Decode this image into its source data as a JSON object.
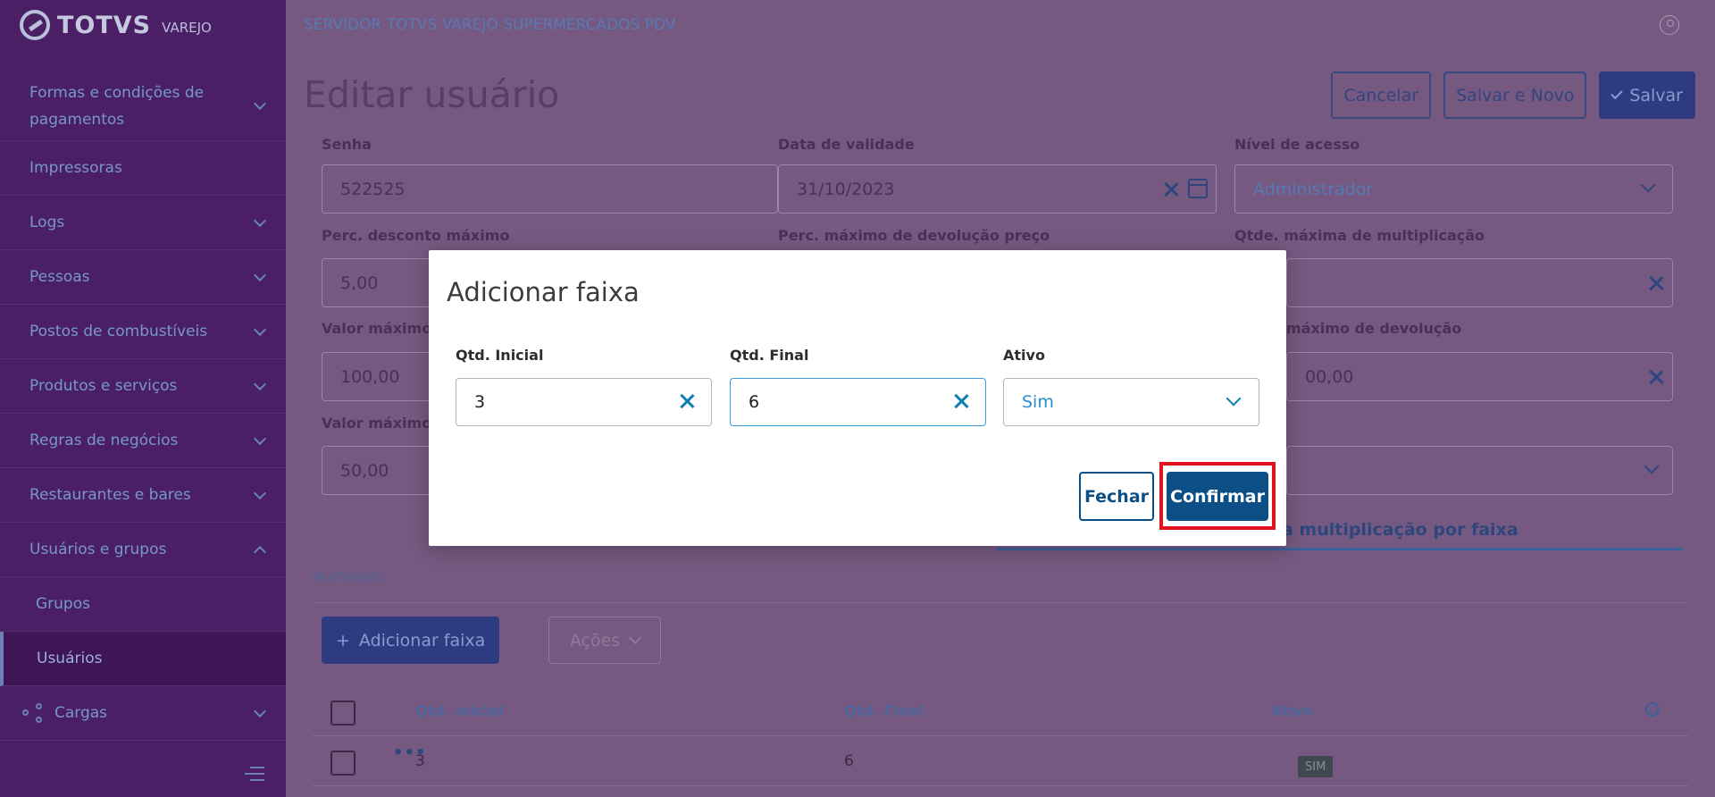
{
  "brand": {
    "name": "TOTVS",
    "sub": "VAREJO"
  },
  "header": {
    "server_title": "SERVIDOR TOTVS VAREJO SUPERMERCADOS PDV"
  },
  "sidebar": {
    "items": [
      {
        "label": "Formas e condições de pagamentos"
      },
      {
        "label": "Impressoras"
      },
      {
        "label": "Logs"
      },
      {
        "label": "Pessoas"
      },
      {
        "label": "Postos de combustíveis"
      },
      {
        "label": "Produtos e serviços"
      },
      {
        "label": "Regras de negócios"
      },
      {
        "label": "Restaurantes e bares"
      },
      {
        "label": "Usuários e grupos"
      },
      {
        "label": "Grupos"
      },
      {
        "label": "Usuários"
      },
      {
        "label": "Cargas"
      }
    ]
  },
  "page": {
    "title": "Editar usuário",
    "cancel_label": "Cancelar",
    "save_new_label": "Salvar e Novo",
    "save_label": "Salvar"
  },
  "form": {
    "senha_label": "Senha",
    "senha_value": "522525",
    "validade_label": "Data de validade",
    "validade_value": "31/10/2023",
    "nivel_label": "Nível de acesso",
    "nivel_value": "Administrador",
    "perc_desc_label": "Perc. desconto máximo",
    "perc_desc_value": "5,00",
    "perc_dev_label": "Perc. máximo de devolução preço",
    "qtd_mult_label": "Qtde. máxima de multiplicação",
    "valor_max_label": "Valor máximo c",
    "valor_max_value": "100,00",
    "max_dev_label": "máximo de devolução",
    "max_dev_value": "00,00",
    "valor_max2_label": "Valor máximo p",
    "valor_max2_value": "50,00"
  },
  "tabs": {
    "active_label": "a multiplicação por faixa"
  },
  "multifaixas": {
    "section_label": "MULTFAIXAS",
    "add_label": "Adicionar faixa",
    "acoes_label": "Ações",
    "columns": [
      "Qtd. Inicial",
      "Qtd. Final",
      "Ativo"
    ],
    "rows": [
      {
        "inicial": "3",
        "final": "6",
        "ativo": "SIM"
      }
    ]
  },
  "modal": {
    "title": "Adicionar faixa",
    "qtd_inicial_label": "Qtd. Inicial",
    "qtd_inicial_value": "3",
    "qtd_final_label": "Qtd. Final",
    "qtd_final_value": "6",
    "ativo_label": "Ativo",
    "ativo_value": "Sim",
    "fechar_label": "Fechar",
    "confirmar_label": "Confirmar"
  },
  "colors": {
    "sidebar": "#4a1f66",
    "primary": "#0b4f86",
    "highlight": "#e1141e"
  }
}
